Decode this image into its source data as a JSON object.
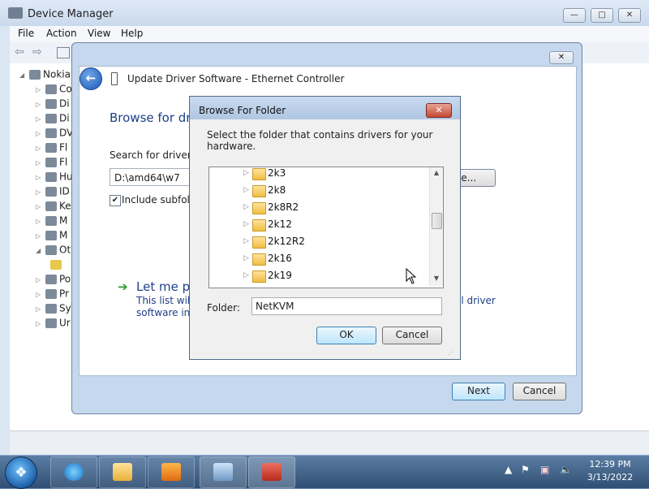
{
  "device_manager": {
    "title": "Device Manager",
    "menu": [
      "File",
      "Action",
      "View",
      "Help"
    ],
    "tree_root": "Nokia",
    "tree_items": [
      "Co",
      "Di",
      "Di",
      "DV",
      "Fl",
      "Fl",
      "Hu",
      "ID",
      "Ke",
      "M",
      "M",
      "Ot",
      "",
      "Po",
      "Pr",
      "Sy",
      "Ur"
    ]
  },
  "wizard": {
    "title": "Update Driver Software - Ethernet Controller",
    "heading": "Browse for dri",
    "search_label": "Search for driver so",
    "path_value": "D:\\amd64\\w7",
    "browse_label": "se...",
    "include_subfolders_label": "Include subfold",
    "include_subfolders_checked": true,
    "letme_label": "Let me pi",
    "list_desc_line1": "This list will s",
    "list_desc_line2": "software in t",
    "list_desc_right": "ll driver",
    "next_label": "Next",
    "cancel_label": "Cancel"
  },
  "browse_folder": {
    "title": "Browse For Folder",
    "description": "Select the folder that contains drivers for your hardware.",
    "folders": [
      "2k3",
      "2k8",
      "2k8R2",
      "2k12",
      "2k12R2",
      "2k16",
      "2k19"
    ],
    "folder_label": "Folder:",
    "folder_value": "NetKVM",
    "ok_label": "OK",
    "cancel_label": "Cancel"
  },
  "taskbar": {
    "time": "12:39 PM",
    "date": "3/13/2022",
    "pinned": [
      "internet-explorer",
      "windows-explorer",
      "media-player",
      "device-manager",
      "toolbox"
    ]
  }
}
